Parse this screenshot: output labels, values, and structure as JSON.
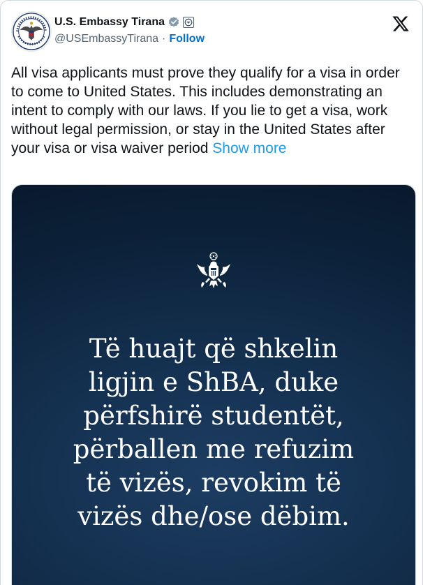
{
  "account": {
    "display_name": "U.S. Embassy Tirana",
    "handle": "@USEmbassyTirana",
    "separator": "·",
    "follow_label": "Follow",
    "verified_icon": "verified-check-icon",
    "affiliation_icon": "government-seal-badge-icon",
    "avatar_icon": "embassy-seal-icon"
  },
  "platform": {
    "logo_icon": "x-logo-icon"
  },
  "tweet": {
    "text": "All visa applicants must prove they qualify for a visa in order to come to United States. This includes demonstrating an intent to comply with our laws. If you lie to get a visa, work without legal permission, or stay in the United States after your visa or visa waiver period ",
    "show_more_label": "Show more"
  },
  "media": {
    "emblem_icon": "great-seal-eagle-icon",
    "caption": "Të huajt që shkelin\nligjin e ShBA, duke\npërfshirë studentët,\npërballen me refuzim\ntë vizës, revokim të\nvizës dhe/ose dëbim.",
    "background_color": "#14304f"
  },
  "colors": {
    "link": "#1d9bf0",
    "follow": "#006fd6",
    "text": "#0f1419",
    "secondary": "#536471"
  }
}
